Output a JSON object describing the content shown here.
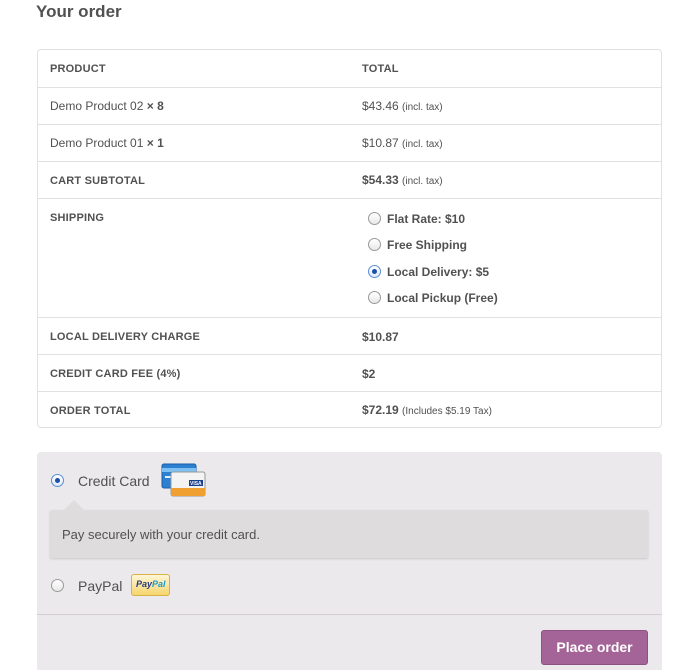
{
  "heading": "Your order",
  "table": {
    "col_product": "PRODUCT",
    "col_total": "TOTAL",
    "items": [
      {
        "name": "Demo Product 02",
        "qty": "× 8",
        "price": "$43.46",
        "tax_note": "(incl. tax)"
      },
      {
        "name": "Demo Product 01",
        "qty": "× 1",
        "price": "$10.87",
        "tax_note": "(incl. tax)"
      }
    ],
    "subtotal_label": "CART SUBTOTAL",
    "subtotal_value": "$54.33",
    "subtotal_note": "(incl. tax)",
    "shipping_label": "SHIPPING",
    "shipping_options": [
      {
        "label": "Flat Rate: $10",
        "checked": false
      },
      {
        "label": "Free Shipping",
        "checked": false
      },
      {
        "label": "Local Delivery: $5",
        "checked": true
      },
      {
        "label": "Local Pickup (Free)",
        "checked": false
      }
    ],
    "local_delivery_label": "LOCAL DELIVERY CHARGE",
    "local_delivery_value": "$10.87",
    "cc_fee_label": "CREDIT CARD FEE (4%)",
    "cc_fee_value": "$2",
    "total_label": "ORDER TOTAL",
    "total_value": "$72.19",
    "total_note": "(Includes $5.19 Tax)"
  },
  "payment": {
    "credit_card_label": "Credit Card",
    "credit_card_selected": true,
    "credit_card_description": "Pay securely with your credit card.",
    "paypal_label": "PayPal",
    "paypal_selected": false,
    "paypal_logo_pay": "Pay",
    "paypal_logo_pal": "Pal",
    "cc_logo_text": "VISA",
    "place_order_label": "Place order"
  },
  "colors": {
    "button_bg": "#a46497",
    "panel_bg": "#ebe9eb",
    "text": "#515151"
  }
}
